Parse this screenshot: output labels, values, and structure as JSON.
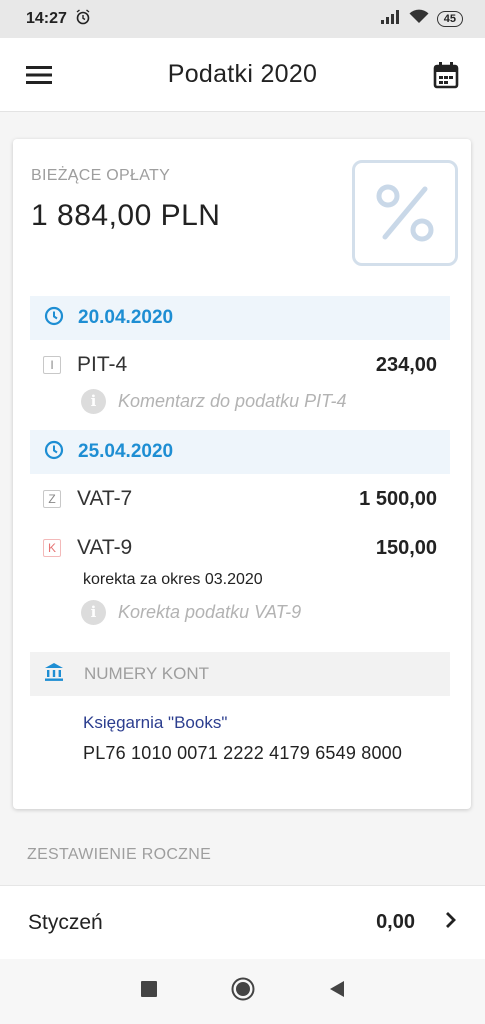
{
  "status_bar": {
    "time": "14:27",
    "battery": "45"
  },
  "app_bar": {
    "title": "Podatki 2020",
    "menu_icon": "hamburger-menu-icon",
    "calendar_icon": "calendar-icon"
  },
  "current_fees": {
    "label": "BIEŻĄCE OPŁATY",
    "amount": "1 884,00 PLN",
    "groups": [
      {
        "date": "20.04.2020",
        "items": [
          {
            "badge": "I",
            "name": "PIT-4",
            "value": "234,00",
            "comment": "Komentarz do podatku PIT-4"
          }
        ]
      },
      {
        "date": "25.04.2020",
        "items": [
          {
            "badge": "Z",
            "name": "VAT-7",
            "value": "1 500,00"
          },
          {
            "badge": "K",
            "name": "VAT-9",
            "value": "150,00",
            "note": "korekta za okres 03.2020",
            "comment": "Korekta podatku VAT-9"
          }
        ]
      }
    ],
    "accounts": {
      "label": "NUMERY KONT",
      "name": "Księgarnia \"Books\"",
      "number": "PL76 1010 0071 2222 4179 6549 8000"
    }
  },
  "annual_summary": {
    "label": "ZESTAWIENIE ROCZNE",
    "months": [
      {
        "name": "Styczeń",
        "value": "0,00"
      }
    ]
  },
  "colors": {
    "accent_blue": "#1e8ed3",
    "account_name": "#2c3e8f",
    "badge_red": "#e57373"
  }
}
